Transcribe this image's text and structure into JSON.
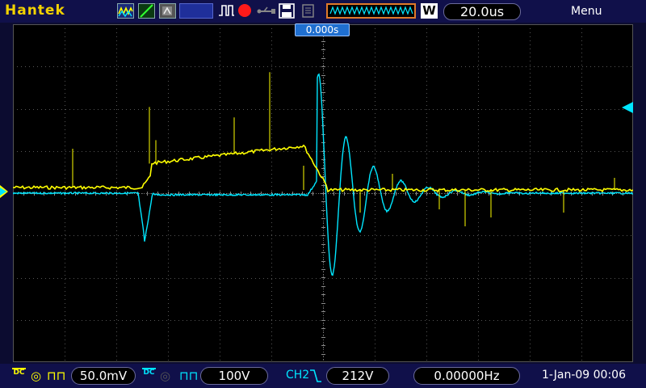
{
  "brand": "Hantek",
  "timebase": "20.0us",
  "menu_label": "Menu",
  "trigger_time": "0.000s",
  "w_label": "W",
  "ch1": {
    "coupling": "DC",
    "volts_div": "50.0mV",
    "color": "#ffff00"
  },
  "ch2": {
    "coupling": "DC",
    "volts_div": "100V",
    "color": "#00e6ff"
  },
  "trigger": {
    "source": "CH2",
    "level": "212V"
  },
  "frequency": "0.00000Hz",
  "datetime": "1-Jan-09 00:06",
  "colors": {
    "ch1": "#ffff00",
    "ch2": "#00e6ff",
    "grid": "#5a5a5a",
    "background": "#000000"
  }
}
